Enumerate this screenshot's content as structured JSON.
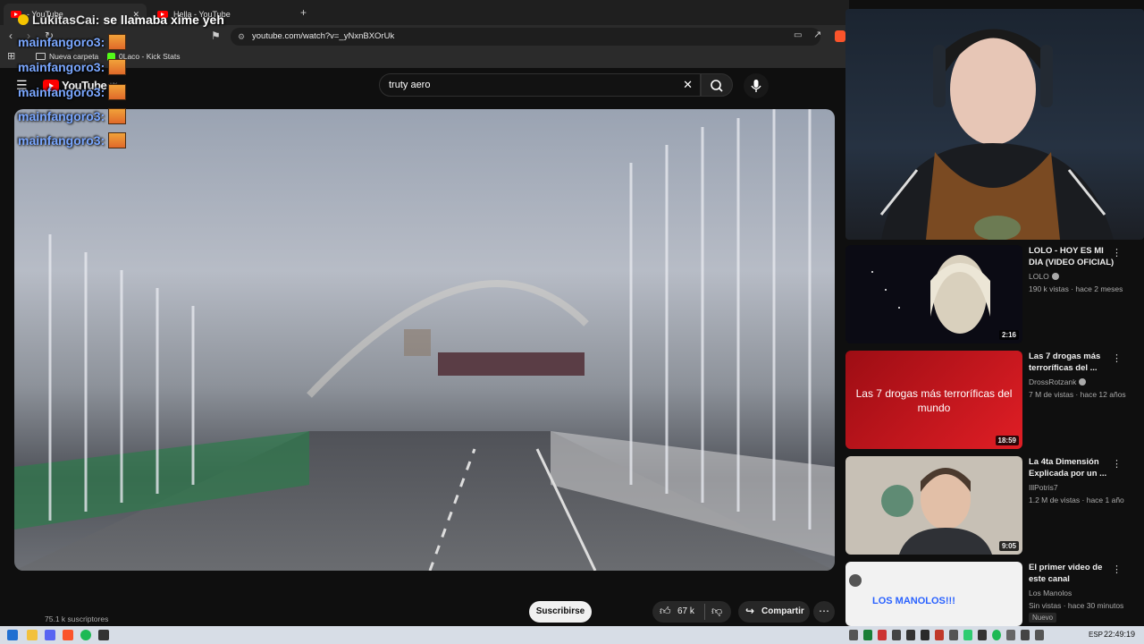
{
  "browser": {
    "tabs": [
      {
        "label": "- YouTube"
      },
      {
        "label": "Hella - YouTube"
      }
    ],
    "new_tab_symbol": "+",
    "url": "youtube.com/watch?v=_yNxnBXOrUk",
    "bookmarks": [
      {
        "label": "Nueva carpeta"
      },
      {
        "label": "0Laco - Kick Stats"
      }
    ]
  },
  "youtube": {
    "logo_text": "YouTube",
    "region": "UY",
    "search_query": "truty aero"
  },
  "chat": {
    "top_user": "LukitasCai:",
    "top_message": "se llamaba xime yeh",
    "repeated_user": "mainfangoro3:",
    "repeat_lines": [
      "mainfangoro3:",
      "mainfangoro3:",
      "mainfangoro3:",
      "mainfangoro3:",
      "mainfangoro3:"
    ]
  },
  "video": {
    "subscribers": "75.1 k suscriptores",
    "subscribe_label": "Suscribirse",
    "likes": "67 k",
    "share_label": "Compartir",
    "more_symbol": "⋯"
  },
  "sidebar": [
    {
      "title": "LOLO - HOY ES MI DIA (VIDEO OFICIAL)",
      "channel": "LOLO",
      "verified": true,
      "meta": "190 k vistas · hace 2 meses",
      "duration": "2:16",
      "thumb_colors": [
        "#0b0b14",
        "#d9d0bd"
      ]
    },
    {
      "title": "Las 7 drogas más terroríficas del ...",
      "channel": "DrossRotzank",
      "verified": true,
      "meta": "7 M de vistas · hace 12 años",
      "duration": "18:59",
      "thumb_text": "Las 7 drogas más terroríficas del mundo",
      "thumb_colors": [
        "#9d0d14",
        "#e01e25"
      ]
    },
    {
      "title": "La 4ta Dimensión Explicada por un ...",
      "channel": "IllPotris7",
      "verified": false,
      "meta": "1.2 M de vistas · hace 1 año",
      "duration": "9:05",
      "thumb_colors": [
        "#c7c0b5",
        "#4b3a2e"
      ]
    },
    {
      "title": "El primer video de este canal",
      "channel": "Los Manolos",
      "verified": false,
      "meta": "Sin vistas · hace 30 minutos",
      "badge": "Nuevo",
      "thumb_text": "LOS MANOLOS!!!",
      "thumb_colors": [
        "#f2f2f2",
        "#2a62ff"
      ]
    }
  ],
  "taskbar": {
    "lang": "ESP",
    "time": "22:49:19"
  }
}
